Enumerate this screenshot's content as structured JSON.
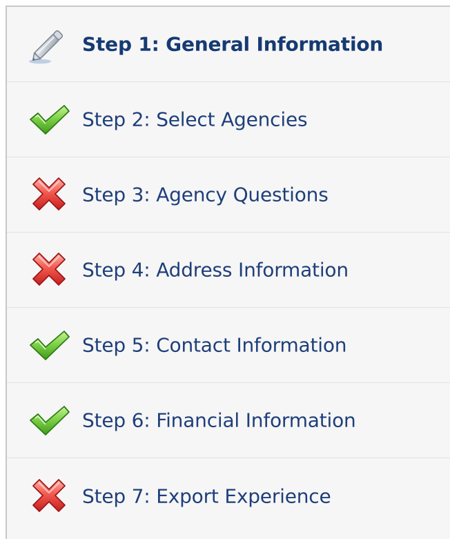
{
  "steps": [
    {
      "label": "Step 1: General Information",
      "status": "current",
      "icon": "pencil-icon"
    },
    {
      "label": "Step 2: Select Agencies",
      "status": "complete",
      "icon": "checkmark-icon"
    },
    {
      "label": "Step 3: Agency Questions",
      "status": "incomplete",
      "icon": "x-icon"
    },
    {
      "label": "Step 4: Address Information",
      "status": "incomplete",
      "icon": "x-icon"
    },
    {
      "label": "Step 5: Contact Information",
      "status": "complete",
      "icon": "checkmark-icon"
    },
    {
      "label": "Step 6: Financial Information",
      "status": "complete",
      "icon": "checkmark-icon"
    },
    {
      "label": "Step 7: Export Experience",
      "status": "incomplete",
      "icon": "x-icon"
    }
  ],
  "colors": {
    "label": "#1f3f7a",
    "check": "#5fb92e",
    "cross": "#e23b3b",
    "background": "#f6f6f6",
    "divider": "#e2e2e2"
  }
}
